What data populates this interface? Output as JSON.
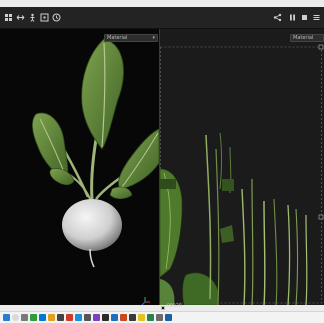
{
  "toolbar": {
    "icons": [
      "grid-icon",
      "arrows-icon",
      "figure-icon",
      "frame-icon",
      "clock-icon",
      "share-icon",
      "pause-icon",
      "stop-icon",
      "menu-icon"
    ]
  },
  "viewport3d": {
    "material_select": "Material"
  },
  "viewport2d": {
    "material_select": "Material",
    "checkbox_label": "PBR3R"
  },
  "taskbar": {
    "icons": [
      "windows-icon",
      "search-icon",
      "taskview-icon",
      "app-1-icon",
      "app-2-icon",
      "app-3-icon",
      "app-4-icon",
      "app-5-icon",
      "app-6-icon",
      "app-7-icon",
      "app-8-icon",
      "app-9-icon",
      "app-10-icon",
      "app-11-icon",
      "app-12-icon",
      "app-13-icon",
      "app-14-icon",
      "app-15-icon",
      "app-16-icon"
    ]
  }
}
